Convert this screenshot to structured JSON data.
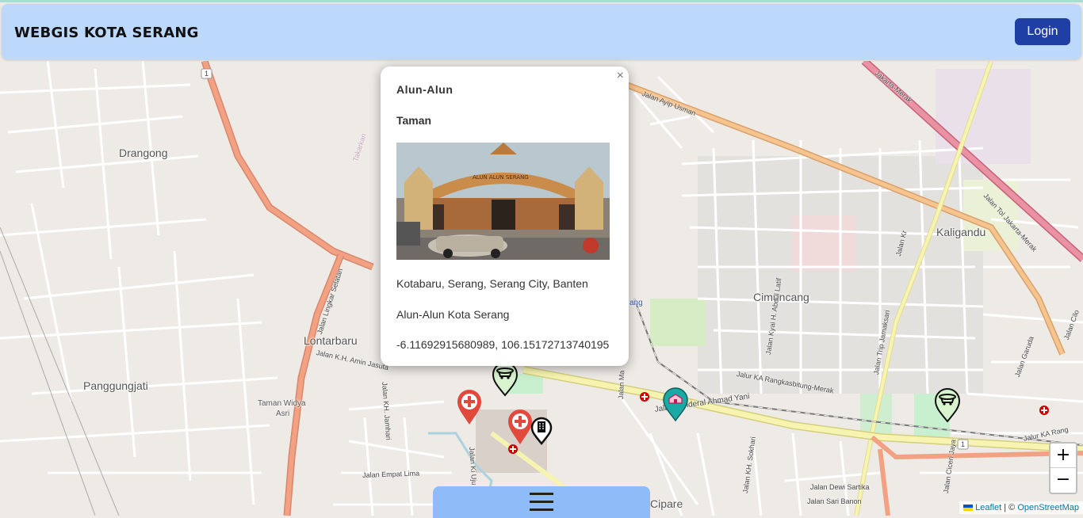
{
  "app": {
    "brand": "WEBGIS KOTA SERANG",
    "login_label": "Login"
  },
  "popup": {
    "close_glyph": "×",
    "title": "Alun-Alun",
    "category": "Taman",
    "photo_sign": "ALUN ALUN SERANG",
    "address": "Kotabaru, Serang, Serang City, Banten",
    "description": "Alun-Alun Kota Serang",
    "coordinates": "-6.11692915680989, 106.15172713740195"
  },
  "map": {
    "places": [
      {
        "name": "Drangong"
      },
      {
        "name": "Lontarbaru"
      },
      {
        "name": "Panggungjati"
      },
      {
        "name": "Taman Widya"
      },
      {
        "name": "Asri"
      },
      {
        "name": "Cimuncang"
      },
      {
        "name": "Kaligandu"
      },
      {
        "name": "Cipare"
      }
    ],
    "streets": [
      "Jalan Ayip Usman",
      "Jakarta-Merak",
      "Jalan Tol Jakarta-Merak",
      "Jalan Lingkar Selatan",
      "Jalan K.H. Amin Jasuta",
      "Jalan Jenderal Ahmad Yani",
      "Jalur KA Rangkasbitung-Merak",
      "Jalan Trip Jamaksari",
      "Jalan Kyai H. Abdul Latif",
      "Jalan Empat Lima",
      "Jalan Dewi Sartika",
      "Jalan Sari Banon",
      "Jalan Garuda",
      "Jalan KH. Sokhari",
      "Jalan Ciceri Jaya",
      "Jalan KH. Jamhari",
      "Jalan Ki Uju",
      "Jalan Ma",
      "Takarkan",
      "Jalan Kr",
      "Jalan Cilo",
      "Jalur KA Rang"
    ],
    "route_shields": [
      "1",
      "1"
    ],
    "partial_label": "ang"
  },
  "zoom": {
    "in": "+",
    "out": "−"
  },
  "attribution": {
    "leaflet": "Leaflet",
    "separator": " | © ",
    "osm": "OpenStreetMap"
  },
  "colors": {
    "navbar": "#bcd8fb",
    "login": "#1f3fa5",
    "bottom_tab": "#8ebcf9"
  },
  "icons": [
    "hospital-marker-icon",
    "park-marker-icon",
    "building-marker-icon",
    "school-marker-icon",
    "hamburger-menu-icon"
  ]
}
